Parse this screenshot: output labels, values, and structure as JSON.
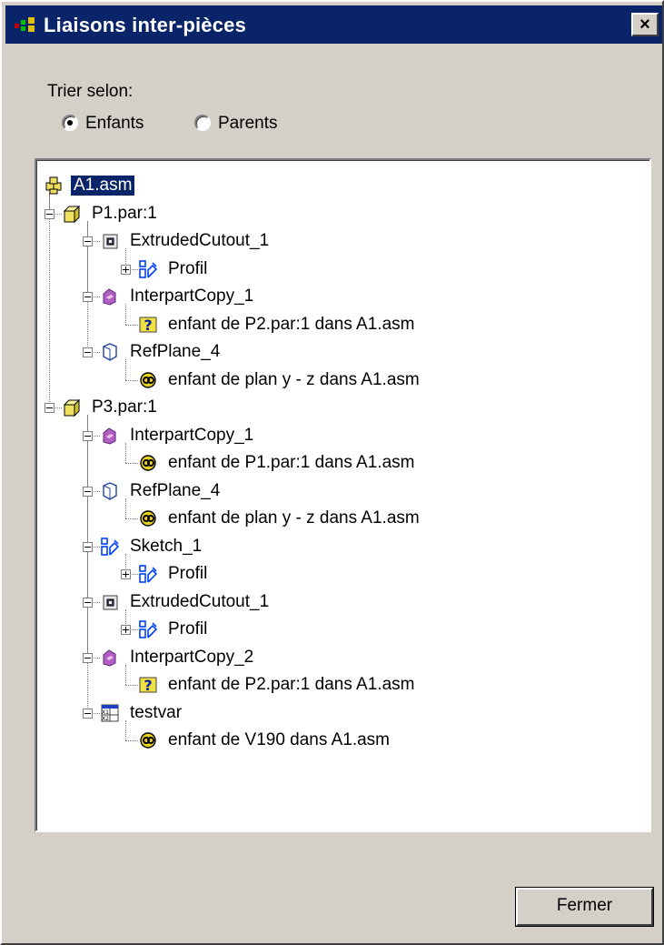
{
  "window": {
    "title": "Liaisons inter-pièces",
    "close_label": "×"
  },
  "sort": {
    "label": "Trier selon:",
    "options": [
      {
        "label": "Enfants",
        "selected": true
      },
      {
        "label": "Parents",
        "selected": false
      }
    ]
  },
  "tree": {
    "nodes": [
      {
        "label": "A1.asm",
        "icon": "assembly-icon",
        "level": 0,
        "selected": true,
        "expander": "none"
      },
      {
        "label": "P1.par:1",
        "icon": "part-icon",
        "level": 1,
        "expander": "minus"
      },
      {
        "label": "ExtrudedCutout_1",
        "icon": "cutout-feature-icon",
        "level": 2,
        "expander": "minus"
      },
      {
        "label": "Profil",
        "icon": "sketch-icon",
        "level": 3,
        "expander": "plus"
      },
      {
        "label": "InterpartCopy_1",
        "icon": "interpart-copy-icon",
        "level": 2,
        "expander": "minus"
      },
      {
        "label": "enfant de P2.par:1 dans A1.asm",
        "icon": "question-icon",
        "level": 3,
        "expander": "none"
      },
      {
        "label": "RefPlane_4",
        "icon": "ref-plane-icon",
        "level": 2,
        "expander": "minus"
      },
      {
        "label": "enfant de plan y - z dans A1.asm",
        "icon": "link-icon",
        "level": 3,
        "expander": "none"
      },
      {
        "label": "P3.par:1",
        "icon": "part-icon",
        "level": 1,
        "expander": "minus"
      },
      {
        "label": "InterpartCopy_1",
        "icon": "interpart-copy-icon",
        "level": 2,
        "expander": "minus"
      },
      {
        "label": "enfant de P1.par:1 dans A1.asm",
        "icon": "link-icon",
        "level": 3,
        "expander": "none"
      },
      {
        "label": "RefPlane_4",
        "icon": "ref-plane-icon",
        "level": 2,
        "expander": "minus"
      },
      {
        "label": "enfant de plan y - z dans A1.asm",
        "icon": "link-icon",
        "level": 3,
        "expander": "none"
      },
      {
        "label": "Sketch_1",
        "icon": "sketch-icon",
        "level": 2,
        "expander": "minus"
      },
      {
        "label": "Profil",
        "icon": "sketch-icon",
        "level": 3,
        "expander": "plus"
      },
      {
        "label": "ExtrudedCutout_1",
        "icon": "cutout-feature-icon",
        "level": 2,
        "expander": "minus"
      },
      {
        "label": "Profil",
        "icon": "sketch-icon",
        "level": 3,
        "expander": "plus"
      },
      {
        "label": "InterpartCopy_2",
        "icon": "interpart-copy-icon",
        "level": 2,
        "expander": "minus"
      },
      {
        "label": "enfant de P2.par:1 dans A1.asm",
        "icon": "question-icon",
        "level": 3,
        "expander": "none"
      },
      {
        "label": "testvar",
        "icon": "variable-table-icon",
        "level": 2,
        "expander": "minus"
      },
      {
        "label": "enfant de V190 dans A1.asm",
        "icon": "link-icon",
        "level": 3,
        "expander": "none"
      }
    ]
  },
  "buttons": {
    "close_label": "Fermer"
  },
  "colors": {
    "titlebar": "#0a246a",
    "dialog_bg": "#d4d0c8",
    "selection": "#0a246a"
  }
}
